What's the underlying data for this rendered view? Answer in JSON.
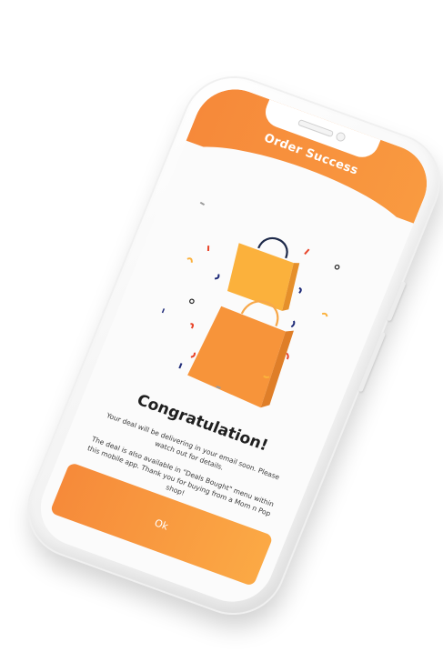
{
  "header": {
    "title": "Order Success"
  },
  "content": {
    "heading": "Congratulation!",
    "message_1": "Your deal will be delivering in your email soon. Please watch out for details.",
    "message_2": "The deal is also available in \"Deals Bought\" menu within this mobile app. Thank you for buying from a Mom n Pop shop!"
  },
  "actions": {
    "ok_label": "Ok"
  },
  "colors": {
    "accent": "#f68a3a",
    "accent_light": "#fba945",
    "bag_small": "#fbb13c",
    "bag_large": "#f7943a",
    "confetti_red": "#e8452a",
    "confetti_navy": "#1e2a78",
    "confetti_gray": "#9a9a9a"
  },
  "icons": {
    "illustration": "shopping-bags-confetti"
  }
}
